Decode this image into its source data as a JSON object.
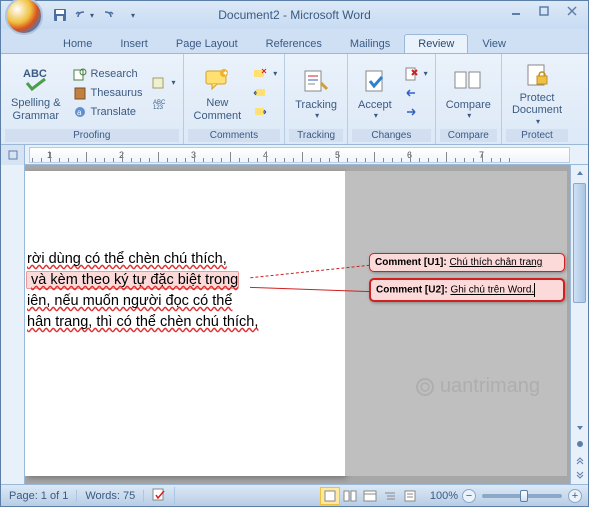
{
  "title": "Document2 - Microsoft Word",
  "qat": {
    "save": "💾",
    "undo": "↶",
    "redo": "↷",
    "more": "▾"
  },
  "tabs": [
    "Home",
    "Insert",
    "Page Layout",
    "References",
    "Mailings",
    "Review",
    "View"
  ],
  "activeTab": "Review",
  "ribbon": {
    "proofing": {
      "label": "Proofing",
      "spelling": "Spelling &\nGrammar",
      "research": "Research",
      "thesaurus": "Thesaurus",
      "translate": "Translate"
    },
    "comments": {
      "label": "Comments",
      "new": "New\nComment"
    },
    "tracking": {
      "label": "Tracking",
      "btn": "Tracking"
    },
    "changes": {
      "label": "Changes",
      "accept": "Accept"
    },
    "compare": {
      "label": "Compare",
      "btn": "Compare"
    },
    "protect": {
      "label": "Protect",
      "btn": "Protect\nDocument"
    }
  },
  "ruler_numbers": [
    "1",
    "2",
    "3",
    "4",
    "5",
    "6",
    "7"
  ],
  "document": {
    "lines": [
      "rời dùng có thể chèn chú thích,",
      "và kèm theo ký tự đặc biệt trong",
      "iên, nếu muốn người đọc có thể",
      "hân trang, thì có thể chèn chú thích,"
    ]
  },
  "comments": [
    {
      "label": "Comment [U1]:",
      "text": "Chú thích chân trang"
    },
    {
      "label": "Comment [U2]:",
      "text": "Ghi chú trên Word."
    }
  ],
  "status": {
    "page": "Page: 1 of 1",
    "words": "Words: 75",
    "zoom": "100%"
  },
  "watermark": "uantrimang"
}
